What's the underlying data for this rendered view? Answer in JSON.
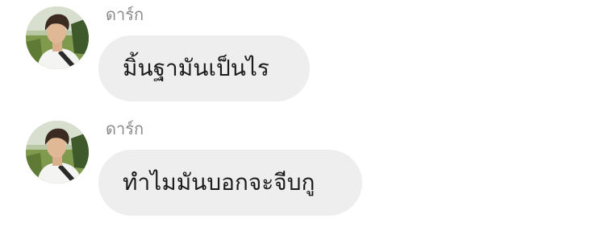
{
  "messages": [
    {
      "sender": "ดาร์ก",
      "avatar_icon": "profile-photo-icon",
      "text": "มิ้นฐามันเป็นไร"
    },
    {
      "sender": "ดาร์ก",
      "avatar_icon": "profile-photo-icon",
      "text": "ทำไมมันบอกจะจีบกู"
    }
  ],
  "colors": {
    "background": "#ffffff",
    "bubble": "#eeeeee",
    "sender_name": "#8a8a8a",
    "message_text": "#1c1c1c"
  }
}
